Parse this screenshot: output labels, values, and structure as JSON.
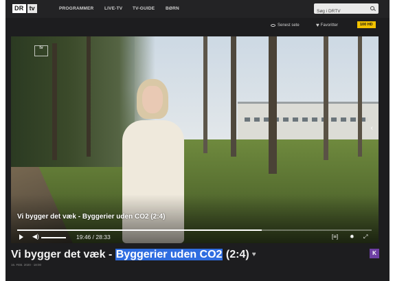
{
  "header": {
    "logo_dr": "DR",
    "logo_tv": "tv",
    "nav": [
      "PROGRAMMER",
      "LIVE-TV",
      "TV-GUIDE",
      "BØRN"
    ],
    "search_placeholder": "Søg i DRTV"
  },
  "subbar": {
    "recently_seen": "Senest sete",
    "favorites": "Favoritter",
    "badge": "100 HD"
  },
  "video": {
    "watermark": "tv",
    "title": "Vi bygger det væk - Byggerier uden CO2 (2:4)",
    "current_time": "19:46",
    "separator": "/",
    "duration": "28:33",
    "progress_fraction": 0.69
  },
  "program": {
    "title_prefix": "Vi bygger det væk - ",
    "title_highlight": "Byggerier uden CO2",
    "title_suffix": " (2:4)",
    "badge": "K",
    "meta": "16. FEB. 2020 · 18:00"
  },
  "icons": {
    "search": "search-icon",
    "eye": "eye-icon",
    "heart": "heart-icon",
    "play": "play-icon",
    "volume": "volume-icon",
    "subtitles": "subtitles-icon",
    "settings": "gear-icon",
    "fullscreen": "fullscreen-icon"
  },
  "colors": {
    "background": "#1d1d1f",
    "highlight": "#2f6de0",
    "badge_yellow": "#f2c200",
    "k_badge": "#6d3fa3"
  }
}
